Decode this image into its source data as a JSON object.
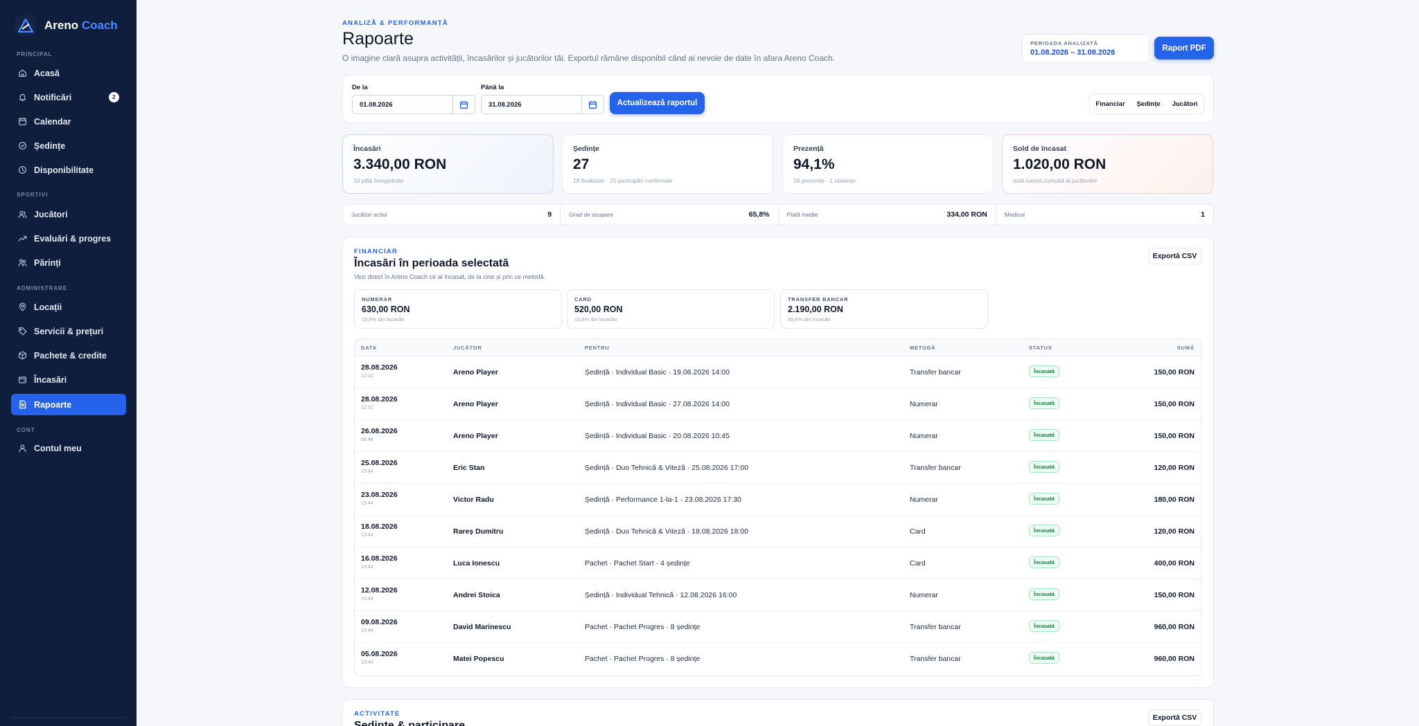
{
  "brand": {
    "name": "Areno",
    "accent": "Coach"
  },
  "sidebar": {
    "sections": [
      {
        "label": "PRINCIPAL"
      },
      {
        "label": "SPORTIVI"
      },
      {
        "label": "ADMINISTRARE"
      },
      {
        "label": "CONT"
      }
    ],
    "items": [
      {
        "label": "Acasă",
        "icon": "home-icon"
      },
      {
        "label": "Notificări",
        "icon": "bell-icon",
        "badge": "2"
      },
      {
        "label": "Calendar",
        "icon": "calendar-icon"
      },
      {
        "label": "Ședințe",
        "icon": "check-circle-icon"
      },
      {
        "label": "Disponibilitate",
        "icon": "clock-icon"
      },
      {
        "label": "Jucători",
        "icon": "users-icon"
      },
      {
        "label": "Evaluări & progres",
        "icon": "trend-up-icon"
      },
      {
        "label": "Părinți",
        "icon": "parents-icon"
      },
      {
        "label": "Locații",
        "icon": "map-pin-icon"
      },
      {
        "label": "Servicii & prețuri",
        "icon": "tag-icon"
      },
      {
        "label": "Pachete & credite",
        "icon": "box-icon"
      },
      {
        "label": "Încasări",
        "icon": "wallet-icon"
      },
      {
        "label": "Rapoarte",
        "icon": "report-icon",
        "active": true
      },
      {
        "label": "Contul meu",
        "icon": "user-icon"
      }
    ]
  },
  "header": {
    "eyebrow": "ANALIZĂ & PERFORMANȚĂ",
    "title": "Rapoarte",
    "subtitle": "O imagine clară asupra activității, încasărilor și jucătorilor tăi. Exportul rămâne disponibil când ai nevoie de date în afara Areno Coach.",
    "period_label": "PERIOADA ANALIZATĂ",
    "period_value": "01.08.2026 – 31.08.2026",
    "pdf_button": "Raport PDF"
  },
  "filters": {
    "from_label": "De la",
    "from_value": "01.08.2026",
    "to_label": "Până la",
    "to_value": "31.08.2026",
    "update_button": "Actualizează raportul",
    "segments": [
      "Financiar",
      "Ședințe",
      "Jucători"
    ]
  },
  "kpis": [
    {
      "label": "Încasări",
      "value": "3.340,00 RON",
      "note": "10 plăți înregistrate"
    },
    {
      "label": "Ședințe",
      "value": "27",
      "note": "18 finalizate · 25 participări confirmate"
    },
    {
      "label": "Prezență",
      "value": "94,1%",
      "note": "16 prezențe · 1 absențe"
    },
    {
      "label": "Sold de încasat",
      "value": "1.020,00 RON",
      "note": "sold curent cumulat al jucătorilor"
    }
  ],
  "stats": [
    {
      "label": "Jucători activi",
      "value": "9"
    },
    {
      "label": "Grad de ocupare",
      "value": "65,8%"
    },
    {
      "label": "Plată medie",
      "value": "334,00 RON"
    },
    {
      "label": "Medical",
      "value": "1"
    }
  ],
  "financial": {
    "eyebrow": "FINANCIAR",
    "title": "Încasări în perioada selectată",
    "desc": "Vezi direct în Areno Coach ce ai încasat, de la cine și prin ce metodă.",
    "export_button": "Exportă CSV",
    "methods": [
      {
        "label": "NUMERAR",
        "value": "630,00 RON",
        "note": "18,9% din încasări"
      },
      {
        "label": "CARD",
        "value": "520,00 RON",
        "note": "15,6% din încasări"
      },
      {
        "label": "TRANSFER BANCAR",
        "value": "2.190,00 RON",
        "note": "65,6% din încasări"
      }
    ],
    "columns": [
      "DATA",
      "JUCĂTOR",
      "PENTRU",
      "METODĂ",
      "STATUS",
      "SUMĂ"
    ],
    "rows": [
      {
        "date": "28.08.2026",
        "time": "12:10",
        "player": "Areno Player",
        "for": "Ședință · Individual Basic · 19.08.2026 14:00",
        "method": "Transfer bancar",
        "status": "Încasată",
        "sum": "150,00 RON"
      },
      {
        "date": "28.08.2026",
        "time": "12:10",
        "player": "Areno Player",
        "for": "Ședință · Individual Basic · 27.08.2026 14:00",
        "method": "Numerar",
        "status": "Încasată",
        "sum": "150,00 RON"
      },
      {
        "date": "26.08.2026",
        "time": "06:46",
        "player": "Areno Player",
        "for": "Ședință · Individual Basic · 20.08.2026 10:45",
        "method": "Numerar",
        "status": "Încasată",
        "sum": "150,00 RON"
      },
      {
        "date": "25.08.2026",
        "time": "13:44",
        "player": "Eric Stan",
        "for": "Ședință · Duo Tehnică & Viteză · 25.08.2026 17:00",
        "method": "Transfer bancar",
        "status": "Încasată",
        "sum": "120,00 RON"
      },
      {
        "date": "23.08.2026",
        "time": "13:44",
        "player": "Victor Radu",
        "for": "Ședință · Performance 1-la-1 · 23.08.2026 17:30",
        "method": "Numerar",
        "status": "Încasată",
        "sum": "180,00 RON"
      },
      {
        "date": "18.08.2026",
        "time": "13:44",
        "player": "Rareș Dumitru",
        "for": "Ședință · Duo Tehnică & Viteză · 18.08.2026 18:00",
        "method": "Card",
        "status": "Încasată",
        "sum": "120,00 RON"
      },
      {
        "date": "16.08.2026",
        "time": "13:44",
        "player": "Luca Ionescu",
        "for": "Pachet · Pachet Start · 4 ședințe",
        "method": "Card",
        "status": "Încasată",
        "sum": "400,00 RON"
      },
      {
        "date": "12.08.2026",
        "time": "13:44",
        "player": "Andrei Stoica",
        "for": "Ședință · Individual Tehnică · 12.08.2026 16:00",
        "method": "Numerar",
        "status": "Încasată",
        "sum": "150,00 RON"
      },
      {
        "date": "09.08.2026",
        "time": "13:44",
        "player": "David Marinescu",
        "for": "Pachet · Pachet Progres · 8 ședințe",
        "method": "Transfer bancar",
        "status": "Încasată",
        "sum": "960,00 RON"
      },
      {
        "date": "05.08.2026",
        "time": "13:44",
        "player": "Matei Popescu",
        "for": "Pachet · Pachet Progres · 8 ședințe",
        "method": "Transfer bancar",
        "status": "Încasată",
        "sum": "960,00 RON"
      }
    ]
  },
  "activity": {
    "eyebrow": "ACTIVITATE",
    "title": "Ședințe & participare",
    "export_button": "Exportă CSV"
  }
}
